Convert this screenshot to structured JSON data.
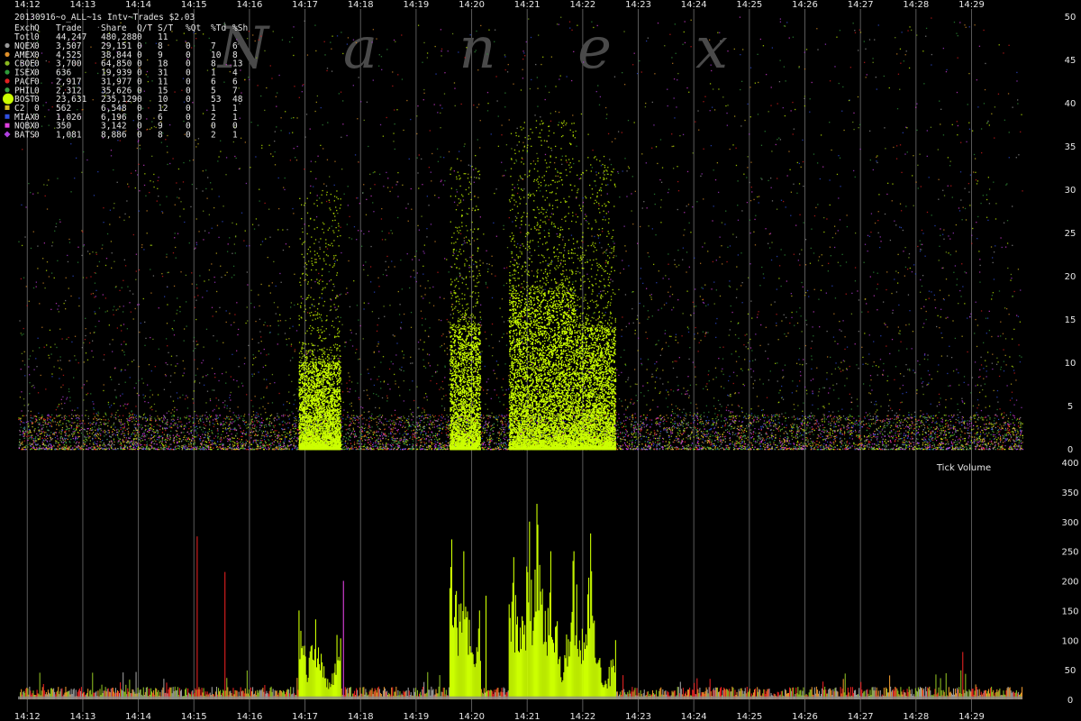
{
  "chart_data": [
    {
      "type": "scatter",
      "title": "20130916~o_ALL~1s Intv~Trades $2.03",
      "watermark": "N a n e x",
      "x_tick_labels": [
        "14:12",
        "14:13",
        "14:14",
        "14:15",
        "14:16",
        "14:17",
        "14:18",
        "14:19",
        "14:20",
        "14:21",
        "14:22",
        "14:23",
        "14:24",
        "14:25",
        "14:26",
        "14:27",
        "14:28",
        "14:29"
      ],
      "y_tick_labels": [
        "0",
        "5",
        "10",
        "15",
        "20",
        "25",
        "30",
        "35",
        "40",
        "45",
        "50"
      ],
      "ylim": [
        0,
        50
      ],
      "grid": true,
      "legend": {
        "placement": "top-left",
        "header": [
          "Exch",
          "Q",
          "Trade",
          "Share",
          "Q/T",
          "S/T",
          "%Qt",
          "%Td",
          "%Sh"
        ],
        "total": [
          "Totl",
          "0",
          "44,247",
          "480,288",
          "0",
          "11",
          "",
          "",
          ""
        ],
        "rows": [
          {
            "exch": "NQEX",
            "q": "0",
            "trade": "3,507",
            "share": "29,151",
            "qt": "0",
            "st": "8",
            "pqt": "0",
            "ptd": "7",
            "psh": "6",
            "color": "#9a9a9a",
            "marker": "circle"
          },
          {
            "exch": "AMEX",
            "q": "0",
            "trade": "4,525",
            "share": "38,844",
            "qt": "0",
            "st": "9",
            "pqt": "0",
            "ptd": "10",
            "psh": "8",
            "color": "#e0902a",
            "marker": "circle"
          },
          {
            "exch": "CBOE",
            "q": "0",
            "trade": "3,700",
            "share": "64,850",
            "qt": "0",
            "st": "18",
            "pqt": "0",
            "ptd": "8",
            "psh": "13",
            "color": "#8ab820",
            "marker": "circle"
          },
          {
            "exch": "ISEX",
            "q": "0",
            "trade": "636",
            "share": "19,939",
            "qt": "0",
            "st": "31",
            "pqt": "0",
            "ptd": "1",
            "psh": "4",
            "color": "#2f9a3a",
            "marker": "circle"
          },
          {
            "exch": "PACF",
            "q": "0",
            "trade": "2,917",
            "share": "31,977",
            "qt": "0",
            "st": "11",
            "pqt": "0",
            "ptd": "6",
            "psh": "6",
            "color": "#e02020",
            "marker": "circle"
          },
          {
            "exch": "PHIL",
            "q": "0",
            "trade": "2,312",
            "share": "35,626",
            "qt": "0",
            "st": "15",
            "pqt": "0",
            "ptd": "5",
            "psh": "7",
            "color": "#3aa040",
            "marker": "circle"
          },
          {
            "exch": "BOST",
            "q": "0",
            "trade": "23,631",
            "share": "235,129",
            "qt": "0",
            "st": "10",
            "pqt": "0",
            "ptd": "53",
            "psh": "48",
            "color": "#ccff00",
            "marker": "big-circle"
          },
          {
            "exch": "C2",
            "q": "0",
            "trade": "562",
            "share": "6,548",
            "qt": "0",
            "st": "12",
            "pqt": "0",
            "ptd": "1",
            "psh": "1",
            "color": "#d8c020",
            "marker": "square"
          },
          {
            "exch": "MIAX",
            "q": "0",
            "trade": "1,026",
            "share": "6,196",
            "qt": "0",
            "st": "6",
            "pqt": "0",
            "ptd": "2",
            "psh": "1",
            "color": "#3050e0",
            "marker": "square"
          },
          {
            "exch": "NQBX",
            "q": "0",
            "trade": "350",
            "share": "3,142",
            "qt": "0",
            "st": "9",
            "pqt": "0",
            "ptd": "0",
            "psh": "0",
            "color": "#e040e0",
            "marker": "square"
          },
          {
            "exch": "BATS",
            "q": "0",
            "trade": "1,081",
            "share": "8,886",
            "qt": "0",
            "st": "8",
            "pqt": "0",
            "ptd": "2",
            "psh": "1",
            "color": "#b040e0",
            "marker": "diamond"
          }
        ]
      },
      "dense_trade_bursts": [
        {
          "exch": "BOST",
          "start": "14:16:53",
          "end": "14:17:38",
          "max_size": 10
        },
        {
          "exch": "BOST",
          "start": "14:19:36",
          "end": "14:20:09",
          "max_size": 14
        },
        {
          "exch": "BOST",
          "start": "14:20:40",
          "end": "14:21:52",
          "max_size": 18
        },
        {
          "exch": "BOST",
          "start": "14:21:52",
          "end": "14:22:35",
          "max_size": 14
        }
      ]
    },
    {
      "type": "bar",
      "title": "Tick Volume",
      "x_tick_labels": [
        "14:12",
        "14:13",
        "14:14",
        "14:15",
        "14:16",
        "14:17",
        "14:18",
        "14:19",
        "14:20",
        "14:21",
        "14:22",
        "14:23",
        "14:24",
        "14:25",
        "14:26",
        "14:27",
        "14:28",
        "14:29"
      ],
      "y_tick_labels": [
        "0",
        "50",
        "100",
        "150",
        "200",
        "250",
        "300",
        "350",
        "400"
      ],
      "ylim": [
        0,
        400
      ],
      "grid": true,
      "baseline_volume": 12,
      "peaks": [
        {
          "time": "14:15:03",
          "value": 275,
          "color": "#e02020"
        },
        {
          "time": "14:15:33",
          "value": 215,
          "color": "#e02020"
        },
        {
          "time": "14:16:53",
          "value": 150,
          "color": "#ccff00"
        },
        {
          "time": "14:17:11",
          "value": 135,
          "color": "#ccff00"
        },
        {
          "time": "14:17:41",
          "value": 200,
          "color": "#e040e0"
        },
        {
          "time": "14:19:38",
          "value": 270,
          "color": "#ccff00"
        },
        {
          "time": "14:19:51",
          "value": 250,
          "color": "#ccff00"
        },
        {
          "time": "14:20:08",
          "value": 150,
          "color": "#ccff00"
        },
        {
          "time": "14:20:15",
          "value": 175,
          "color": "#ccff00"
        },
        {
          "time": "14:20:45",
          "value": 240,
          "color": "#ccff00"
        },
        {
          "time": "14:21:02",
          "value": 300,
          "color": "#ccff00"
        },
        {
          "time": "14:21:10",
          "value": 330,
          "color": "#ccff00"
        },
        {
          "time": "14:21:25",
          "value": 250,
          "color": "#ccff00"
        },
        {
          "time": "14:21:50",
          "value": 250,
          "color": "#ccff00"
        },
        {
          "time": "14:22:08",
          "value": 280,
          "color": "#ccff00"
        },
        {
          "time": "14:22:35",
          "value": 100,
          "color": "#ccff00"
        },
        {
          "time": "14:28:50",
          "value": 80,
          "color": "#e02020"
        }
      ]
    }
  ]
}
